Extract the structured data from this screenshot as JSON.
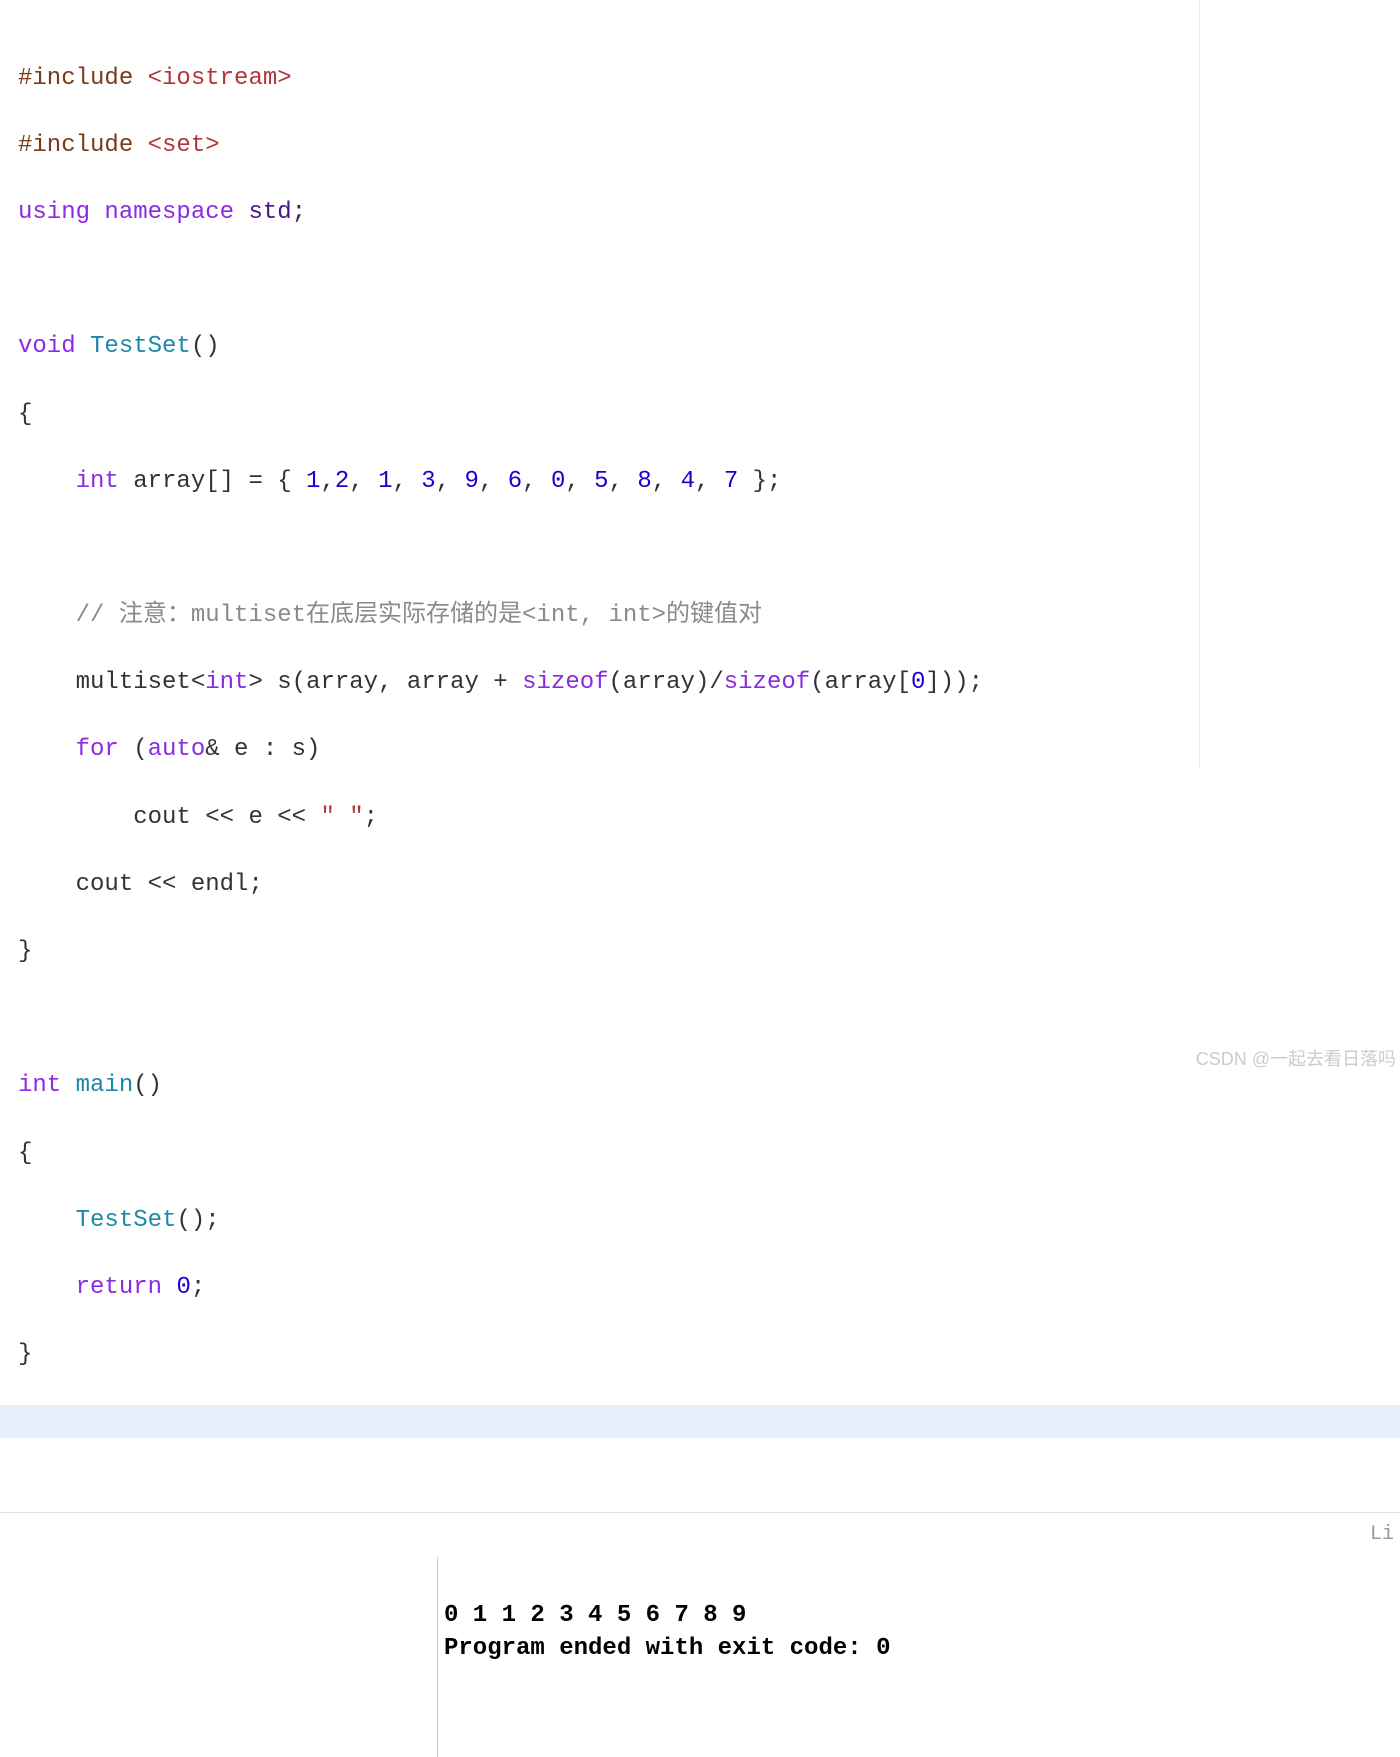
{
  "code": {
    "l1a": "#include ",
    "l1b": "<iostream>",
    "l2a": "#include ",
    "l2b": "<set>",
    "l3a": "using ",
    "l3b": "namespace ",
    "l3c": "std",
    "l3d": ";",
    "l4": "",
    "l5a": "void ",
    "l5b": "TestSet",
    "l5c": "()",
    "l6": "{",
    "l7a": "    ",
    "l7b": "int ",
    "l7c": "array[] = { ",
    "l7d": "1",
    "l7e": ",",
    "l7f": "2",
    "l7g": ", ",
    "l7h": "1",
    "l7i": ", ",
    "l7j": "3",
    "l7k": ", ",
    "l7l": "9",
    "l7m": ", ",
    "l7n": "6",
    "l7o": ", ",
    "l7p": "0",
    "l7q": ", ",
    "l7r": "5",
    "l7s": ", ",
    "l7t": "8",
    "l7u": ", ",
    "l7v": "4",
    "l7w": ", ",
    "l7x": "7",
    "l7y": " };",
    "l8": "",
    "l9a": "    ",
    "l9b": "// 注意：multiset在底层实际存储的是<int, int>的键值对",
    "l10a": "    multiset<",
    "l10b": "int",
    "l10c": "> s(array, array + ",
    "l10d": "sizeof",
    "l10e": "(array)/",
    "l10f": "sizeof",
    "l10g": "(array[",
    "l10h": "0",
    "l10i": "]));",
    "l11a": "    ",
    "l11b": "for ",
    "l11c": "(",
    "l11d": "auto",
    "l11e": "& e : s)",
    "l12a": "        cout << e << ",
    "l12b": "\" \"",
    "l12c": ";",
    "l13": "    cout << endl;",
    "l14": "}",
    "l15": "",
    "l16a": "int ",
    "l16b": "main",
    "l16c": "()",
    "l17": "{",
    "l18a": "    ",
    "l18b": "TestSet",
    "l18c": "();",
    "l19a": "    ",
    "l19b": "return ",
    "l19c": "0",
    "l19d": ";",
    "l20": "}"
  },
  "status_right": "Li",
  "output": {
    "line1": "0 1 1 2 3 4 5 6 7 8 9 ",
    "line2": "Program ended with exit code: 0"
  },
  "watermark": "CSDN @一起去看日落吗"
}
